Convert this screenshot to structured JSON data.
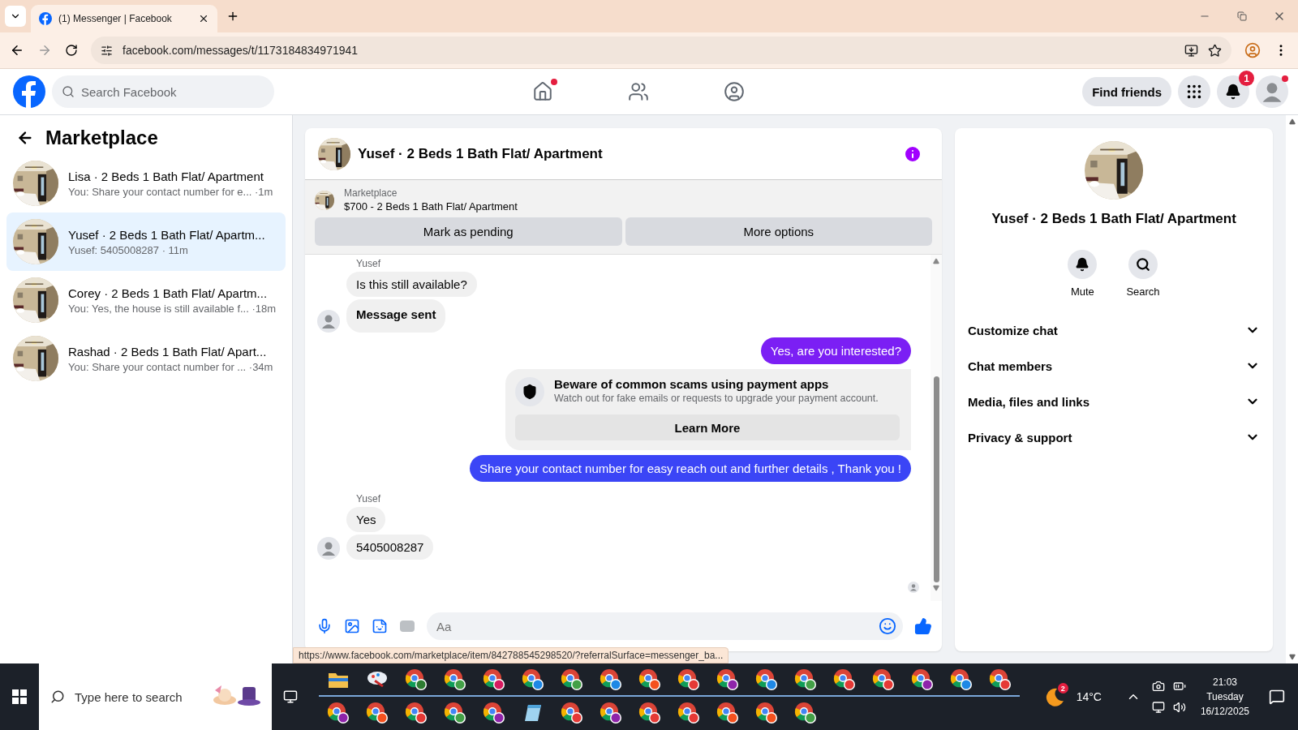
{
  "browser": {
    "tab_title": "(1) Messenger | Facebook",
    "url": "facebook.com/messages/t/1173184834971941",
    "status_url": "https://www.facebook.com/marketplace/item/842788545298520/?referralSurface=messenger_ba..."
  },
  "header": {
    "search": {
      "placeholder": "Search Facebook"
    },
    "nav": [
      {
        "kind": "home",
        "dot": true
      },
      {
        "kind": "friends",
        "dot": false
      },
      {
        "kind": "groups",
        "dot": false
      }
    ],
    "find_friends": "Find friends",
    "notification_count": "1",
    "profile_dot": true
  },
  "sidebar": {
    "title": "Marketplace",
    "chats": [
      {
        "title": "Lisa · 2 Beds 1 Bath Flat/ Apartment",
        "preview": "You: Share your contact number for e... ·1m",
        "selected": false
      },
      {
        "title": "Yusef · 2 Beds 1 Bath Flat/ Apartm...",
        "preview": "Yusef: 5405008287 · 11m",
        "selected": true
      },
      {
        "title": "Corey · 2 Beds 1 Bath Flat/ Apartm...",
        "preview": "You: Yes, the house is still available f... ·18m",
        "selected": false
      },
      {
        "title": "Rashad · 2 Beds 1 Bath Flat/ Apart...",
        "preview": "You: Share your contact number for ... ·34m",
        "selected": false
      }
    ]
  },
  "chat": {
    "title": "Yusef · 2 Beds 1 Bath Flat/ Apartment",
    "listing": {
      "source": "Marketplace",
      "name": "$700 - 2 Beds 1 Bath Flat/ Apartment"
    },
    "actions": [
      "Mark as pending",
      "More options"
    ],
    "messages": [
      {
        "kind": "incoming",
        "sender": "Yusef",
        "bubbles": [
          {
            "text": "Is this still available?",
            "bold": false
          },
          {
            "text": "Message sent",
            "bold": true
          }
        ]
      },
      {
        "kind": "outgoing",
        "text": "Yes, are you interested?",
        "color": "#7b1ff4"
      },
      {
        "kind": "notice",
        "title": "Beware of common scams using payment apps",
        "body": "Watch out for fake emails or requests to upgrade your payment account.",
        "button": "Learn More"
      },
      {
        "kind": "outgoing",
        "text": "Share your contact number for easy reach out and further details , Thank you !",
        "color": "#3b45f6"
      },
      {
        "kind": "incoming",
        "sender": "Yusef",
        "bubbles": [
          {
            "text": "Yes",
            "bold": false
          },
          {
            "text": "5405008287",
            "bold": false
          }
        ]
      }
    ],
    "composer": {
      "placeholder": "Aa"
    }
  },
  "details": {
    "title": "Yusef · 2 Beds 1 Bath Flat/ Apartment",
    "actions": [
      {
        "kind": "mute",
        "label": "Mute"
      },
      {
        "kind": "search",
        "label": "Search"
      }
    ],
    "sections": [
      {
        "label": "Customize chat",
        "expanded": false
      },
      {
        "label": "Chat members",
        "expanded": false
      },
      {
        "label": "Media, files and links",
        "expanded": false
      },
      {
        "label": "Privacy & support",
        "expanded": false
      }
    ]
  },
  "taskbar": {
    "search": {
      "placeholder": "Type here to search"
    },
    "rows": [
      [
        {
          "kind": "folder",
          "running": true
        },
        {
          "kind": "brush",
          "running": true
        },
        {
          "kind": "browser",
          "color": "#2e7d32",
          "running": true
        },
        {
          "kind": "browser",
          "color": "#43a047",
          "running": true
        },
        {
          "kind": "browser",
          "color": "#d81b60",
          "running": true
        },
        {
          "kind": "browser",
          "color": "#1e88e5",
          "running": true
        },
        {
          "kind": "browser",
          "color": "#43a047",
          "running": true
        },
        {
          "kind": "browser",
          "color": "#1e88e5",
          "running": true
        },
        {
          "kind": "browser",
          "color": "#f4511e",
          "running": true
        },
        {
          "kind": "browser",
          "color": "#e53935",
          "running": true
        },
        {
          "kind": "browser",
          "color": "#8e24aa",
          "running": true
        },
        {
          "kind": "browser",
          "color": "#1e88e5",
          "running": true
        },
        {
          "kind": "browser",
          "color": "#43a047",
          "running": true
        },
        {
          "kind": "browser",
          "color": "#e53935",
          "running": true
        },
        {
          "kind": "browser",
          "color": "#e53935",
          "running": true
        },
        {
          "kind": "browser",
          "color": "#8e24aa",
          "running": true
        },
        {
          "kind": "browser",
          "color": "#1e88e5",
          "running": true
        },
        {
          "kind": "browser",
          "color": "#e53935",
          "running": true
        }
      ],
      [
        {
          "kind": "browser",
          "color": "#8e24aa",
          "running": false
        },
        {
          "kind": "browser",
          "color": "#f4511e",
          "running": false
        },
        {
          "kind": "browser",
          "color": "#e53935",
          "running": false
        },
        {
          "kind": "browser",
          "color": "#43a047",
          "running": false
        },
        {
          "kind": "browser",
          "color": "#8e24aa",
          "running": false
        },
        {
          "kind": "notes",
          "running": false
        },
        {
          "kind": "browser",
          "color": "#e53935",
          "running": false
        },
        {
          "kind": "browser",
          "color": "#8e24aa",
          "running": false
        },
        {
          "kind": "browser",
          "color": "#e53935",
          "running": false
        },
        {
          "kind": "browser",
          "color": "#e53935",
          "running": false
        },
        {
          "kind": "browser",
          "color": "#f4511e",
          "running": false
        },
        {
          "kind": "browser",
          "color": "#f4511e",
          "running": false
        },
        {
          "kind": "browser",
          "color": "#43a047",
          "running": false
        }
      ]
    ],
    "weather": {
      "temperature": "14°C",
      "badge": "2"
    },
    "time": "21:03",
    "day": "Tuesday",
    "date": "16/12/2025"
  }
}
